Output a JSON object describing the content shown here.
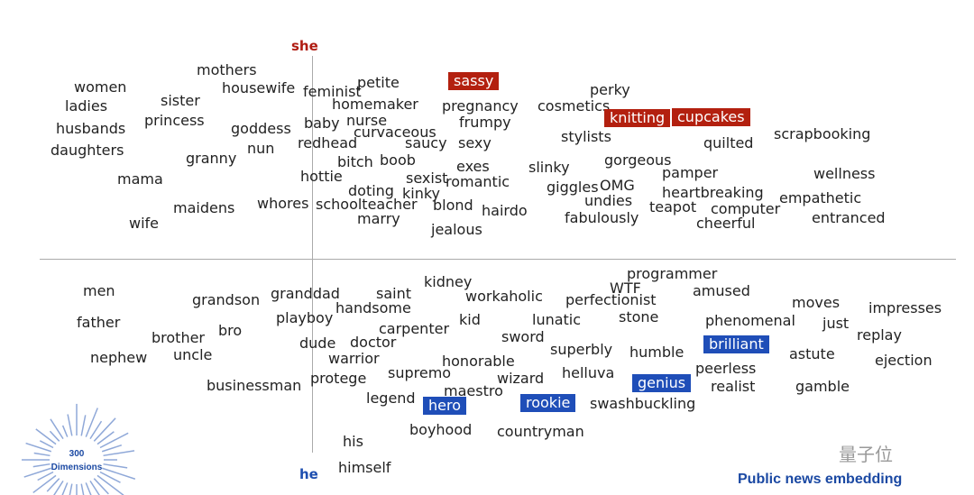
{
  "colors": {
    "she": "#b01c12",
    "he": "#1e4fb0",
    "she_highlight": "#b3200f",
    "he_highlight": "#1f4eb8",
    "caption": "#1b49a3"
  },
  "axis": {
    "top_label": "she",
    "bottom_label": "he"
  },
  "badge": {
    "line1": "300",
    "line2": "Dimensions"
  },
  "caption": "Public news embedding",
  "watermark": "量子位",
  "words": [
    {
      "text": "women"
    },
    {
      "text": "mothers"
    },
    {
      "text": "sister"
    },
    {
      "text": "housewife"
    },
    {
      "text": "feminist"
    },
    {
      "text": "petite"
    },
    {
      "text": "sassy",
      "highlight": "she"
    },
    {
      "text": "ladies"
    },
    {
      "text": "princess"
    },
    {
      "text": "homemaker"
    },
    {
      "text": "pregnancy"
    },
    {
      "text": "perky"
    },
    {
      "text": "cosmetics"
    },
    {
      "text": "husbands"
    },
    {
      "text": "goddess"
    },
    {
      "text": "baby"
    },
    {
      "text": "nurse"
    },
    {
      "text": "frumpy"
    },
    {
      "text": "knitting",
      "highlight": "she"
    },
    {
      "text": "cupcakes",
      "highlight": "she"
    },
    {
      "text": "daughters"
    },
    {
      "text": "nun"
    },
    {
      "text": "curvaceous"
    },
    {
      "text": "redhead"
    },
    {
      "text": "saucy"
    },
    {
      "text": "sexy"
    },
    {
      "text": "stylists"
    },
    {
      "text": "quilted"
    },
    {
      "text": "scrapbooking"
    },
    {
      "text": "granny"
    },
    {
      "text": "bitch"
    },
    {
      "text": "boob"
    },
    {
      "text": "exes"
    },
    {
      "text": "slinky"
    },
    {
      "text": "gorgeous"
    },
    {
      "text": "mama"
    },
    {
      "text": "hottie"
    },
    {
      "text": "sexist"
    },
    {
      "text": "romantic"
    },
    {
      "text": "pamper"
    },
    {
      "text": "wellness"
    },
    {
      "text": "doting"
    },
    {
      "text": "kinky"
    },
    {
      "text": "giggles"
    },
    {
      "text": "OMG"
    },
    {
      "text": "heartbreaking"
    },
    {
      "text": "empathetic"
    },
    {
      "text": "maidens"
    },
    {
      "text": "whores"
    },
    {
      "text": "schoolteacher"
    },
    {
      "text": "blond"
    },
    {
      "text": "hairdo"
    },
    {
      "text": "undies"
    },
    {
      "text": "teapot"
    },
    {
      "text": "computer"
    },
    {
      "text": "wife"
    },
    {
      "text": "marry"
    },
    {
      "text": "fabulously"
    },
    {
      "text": "cheerful"
    },
    {
      "text": "entranced"
    },
    {
      "text": "jealous"
    },
    {
      "text": "programmer"
    },
    {
      "text": "men"
    },
    {
      "text": "kidney"
    },
    {
      "text": "WTF"
    },
    {
      "text": "amused"
    },
    {
      "text": "grandson"
    },
    {
      "text": "granddad"
    },
    {
      "text": "saint"
    },
    {
      "text": "workaholic"
    },
    {
      "text": "perfectionist"
    },
    {
      "text": "moves"
    },
    {
      "text": "impresses"
    },
    {
      "text": "father"
    },
    {
      "text": "handsome"
    },
    {
      "text": "playboy"
    },
    {
      "text": "kid"
    },
    {
      "text": "lunatic"
    },
    {
      "text": "stone"
    },
    {
      "text": "phenomenal"
    },
    {
      "text": "just"
    },
    {
      "text": "bro"
    },
    {
      "text": "carpenter"
    },
    {
      "text": "brother"
    },
    {
      "text": "dude"
    },
    {
      "text": "doctor"
    },
    {
      "text": "sword"
    },
    {
      "text": "replay"
    },
    {
      "text": "brilliant",
      "highlight": "he"
    },
    {
      "text": "nephew"
    },
    {
      "text": "uncle"
    },
    {
      "text": "warrior"
    },
    {
      "text": "superbly"
    },
    {
      "text": "humble"
    },
    {
      "text": "astute"
    },
    {
      "text": "ejection"
    },
    {
      "text": "honorable"
    },
    {
      "text": "peerless"
    },
    {
      "text": "supremo"
    },
    {
      "text": "helluva"
    },
    {
      "text": "businessman"
    },
    {
      "text": "protege"
    },
    {
      "text": "wizard"
    },
    {
      "text": "genius",
      "highlight": "he"
    },
    {
      "text": "realist"
    },
    {
      "text": "gamble"
    },
    {
      "text": "maestro"
    },
    {
      "text": "legend"
    },
    {
      "text": "rookie",
      "highlight": "he"
    },
    {
      "text": "swashbuckling"
    },
    {
      "text": "hero",
      "highlight": "he"
    },
    {
      "text": "boyhood"
    },
    {
      "text": "countryman"
    },
    {
      "text": "his"
    },
    {
      "text": "himself"
    }
  ]
}
